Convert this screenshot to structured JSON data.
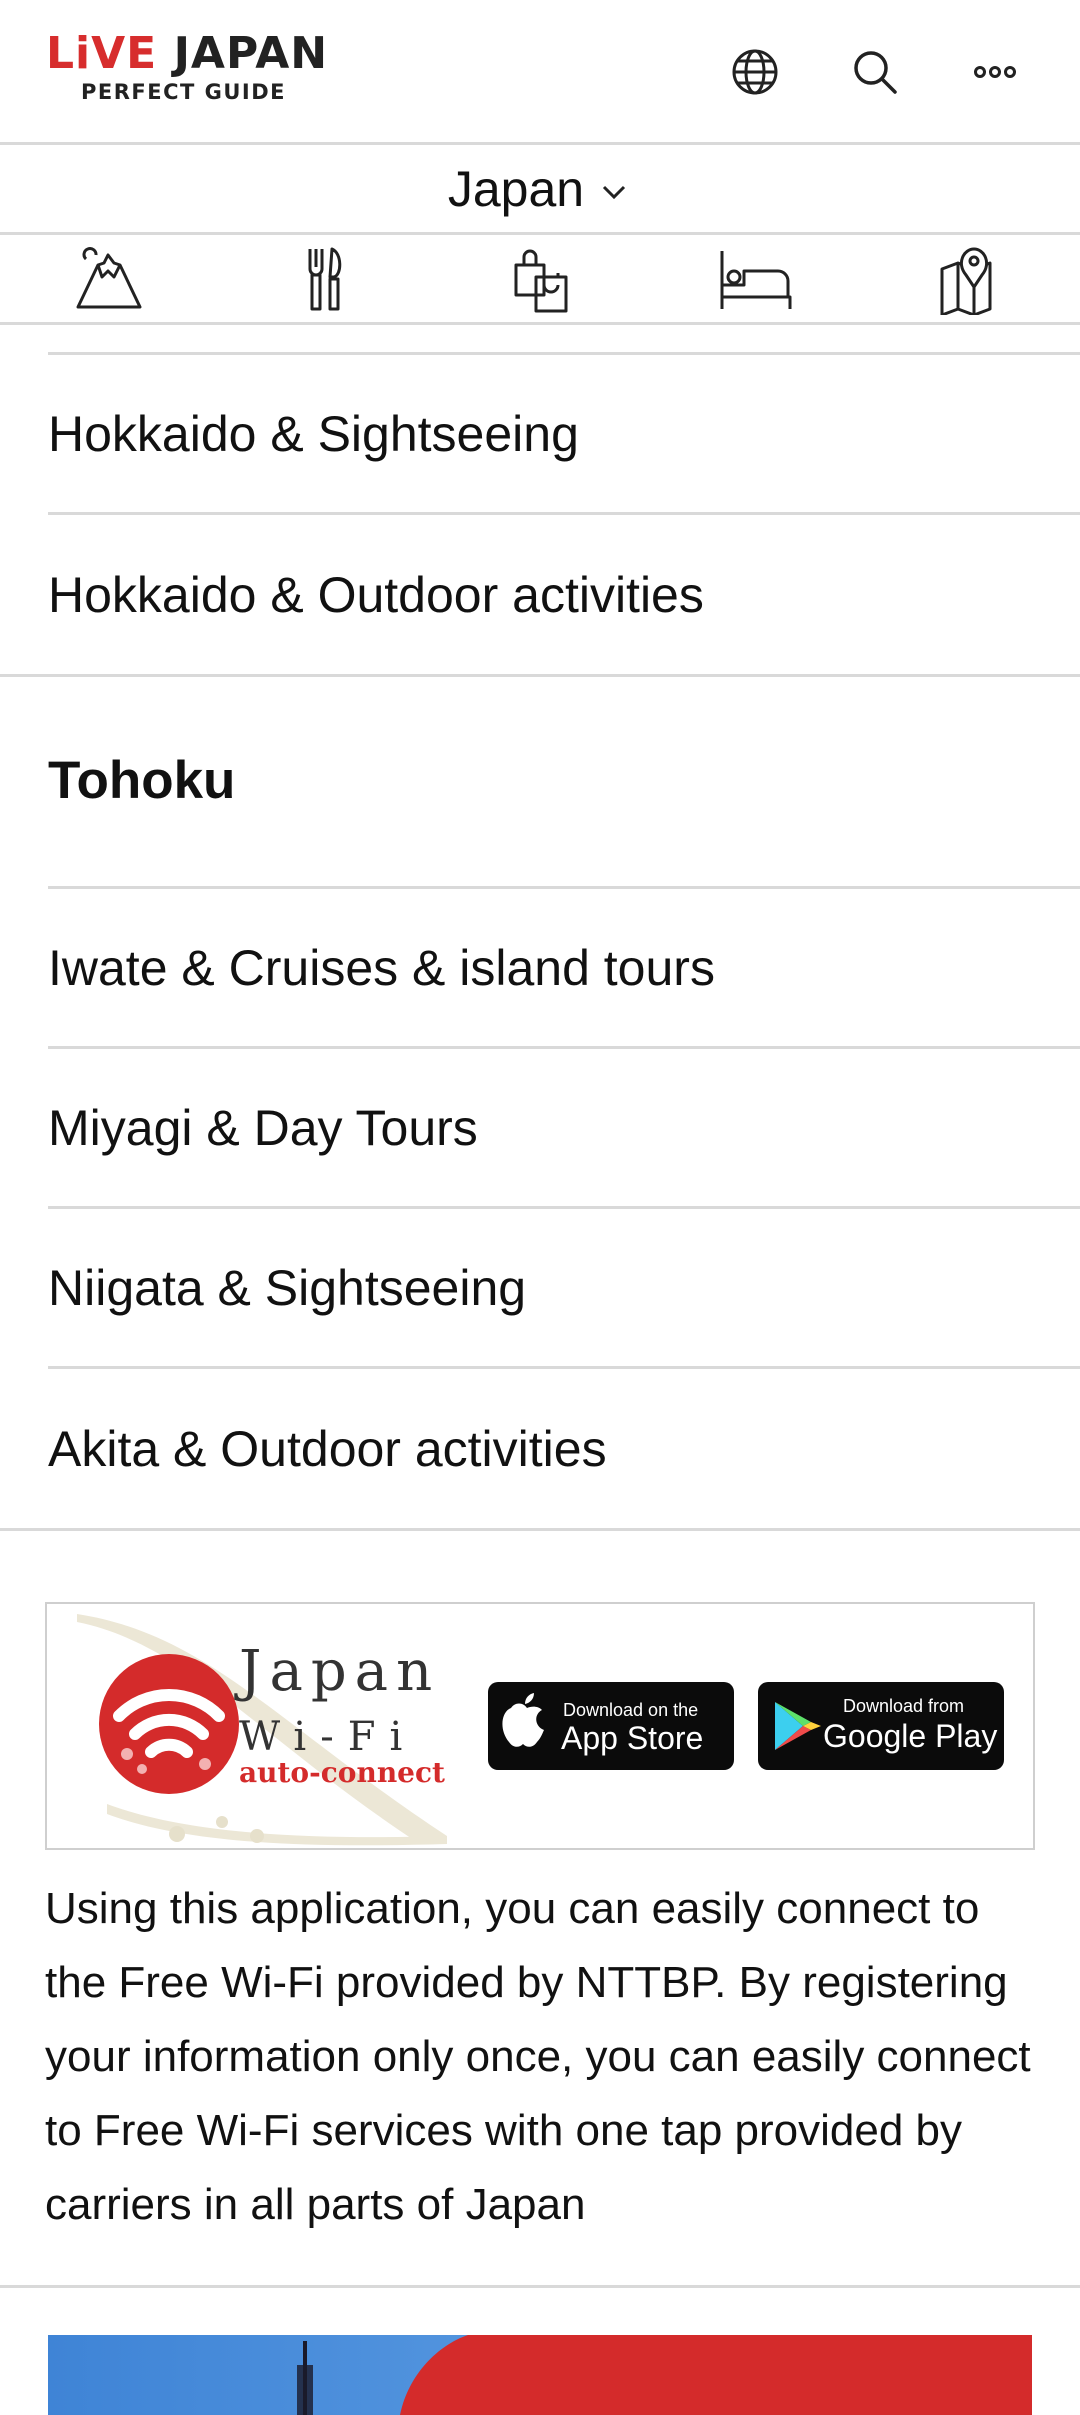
{
  "header": {
    "logo_live": "LiVE",
    "logo_japan": "JAPAN",
    "logo_sub": "PERFECT GUIDE",
    "icons": [
      "globe-icon",
      "search-icon",
      "more-icon"
    ]
  },
  "region_selector": {
    "label": "Japan",
    "icon": "chevron-down-icon"
  },
  "categories": [
    {
      "name": "sightseeing",
      "icon": "mountain-icon"
    },
    {
      "name": "dining",
      "icon": "fork-knife-icon"
    },
    {
      "name": "shopping",
      "icon": "shopping-bags-icon"
    },
    {
      "name": "hotels",
      "icon": "bed-icon"
    },
    {
      "name": "map",
      "icon": "map-pin-icon"
    }
  ],
  "list": {
    "hokkaido_items": [
      "Hokkaido & Sightseeing",
      "Hokkaido & Outdoor activities"
    ],
    "section_title": "Tohoku",
    "tohoku_items": [
      "Iwate & Cruises & island tours",
      "Miyagi & Day Tours",
      "Niigata & Sightseeing",
      "Akita & Outdoor activities"
    ]
  },
  "wifi_banner": {
    "brand_line1": "Japan",
    "brand_line2": "Wi-Fi",
    "brand_line3": "auto-connect",
    "app_store_small": "Download on the",
    "app_store_big": "App Store",
    "google_small": "Download from",
    "google_big": "Google Play",
    "brand_red": "#d42b2b"
  },
  "description": "Using this application, you can easily connect to the Free Wi-Fi provided by NTTBP. By registering your information only once, you can easily connect to Free Wi-Fi services with one tap provided by carriers in all parts of Japan"
}
